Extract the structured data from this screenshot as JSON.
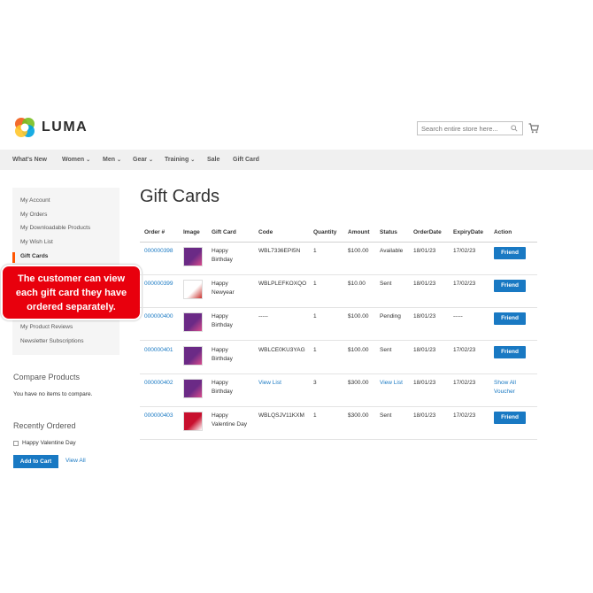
{
  "brand": {
    "name": "LUMA"
  },
  "header": {
    "search_placeholder": "Search entire store here...",
    "cart_icon": "cart-icon"
  },
  "nav": {
    "items": [
      {
        "label": "What's New",
        "dropdown": false
      },
      {
        "label": "Women",
        "dropdown": true
      },
      {
        "label": "Men",
        "dropdown": true
      },
      {
        "label": "Gear",
        "dropdown": true
      },
      {
        "label": "Training",
        "dropdown": true
      },
      {
        "label": "Sale",
        "dropdown": false
      },
      {
        "label": "Gift Card",
        "dropdown": false
      }
    ]
  },
  "sidebar": {
    "items": [
      {
        "label": "My Account",
        "active": false
      },
      {
        "label": "My Orders",
        "active": false
      },
      {
        "label": "My Downloadable Products",
        "active": false
      },
      {
        "label": "My Wish List",
        "active": false
      },
      {
        "label": "Gift Cards",
        "active": true
      },
      {
        "label": "My Product Reviews",
        "active": false
      },
      {
        "label": "Newsletter Subscriptions",
        "active": false
      }
    ],
    "active_color": "#ff5501"
  },
  "callout": {
    "lines": [
      "The customer can view",
      "each gift card they have",
      "ordered separately."
    ],
    "color": "#e8000d"
  },
  "compare": {
    "title": "Compare Products",
    "empty_text": "You have no items to compare."
  },
  "recent": {
    "title": "Recently Ordered",
    "item": "Happy Valentine Day",
    "add_to_cart": "Add to Cart",
    "view_all": "View All"
  },
  "main": {
    "title": "Gift Cards",
    "columns": [
      "Order #",
      "Image",
      "Gift Card",
      "Code",
      "Quantity",
      "Amount",
      "Status",
      "OrderDate",
      "ExpiryDate",
      "Action"
    ],
    "rows": [
      {
        "order": "000000398",
        "gift_card": [
          "Happy",
          "Birthday"
        ],
        "code": "WBL7336EPI5N",
        "code_link": false,
        "quantity": "1",
        "amount": "$100.00",
        "status": "Available",
        "status_link": false,
        "order_date": "18/01/23",
        "expiry_date": "17/02/23",
        "action": [
          "Friend"
        ],
        "action_type": "button",
        "image": "birthday"
      },
      {
        "order": "000000399",
        "gift_card": [
          "Happy",
          "Newyear"
        ],
        "code": "WBLPLEFKOXQO",
        "code_link": false,
        "quantity": "1",
        "amount": "$10.00",
        "status": "Sent",
        "status_link": false,
        "order_date": "18/01/23",
        "expiry_date": "17/02/23",
        "action": [
          "Friend"
        ],
        "action_type": "button",
        "image": "newyear"
      },
      {
        "order": "000000400",
        "gift_card": [
          "Happy",
          "Birthday"
        ],
        "code": "-----",
        "code_link": false,
        "quantity": "1",
        "amount": "$100.00",
        "status": "Pending",
        "status_link": false,
        "order_date": "18/01/23",
        "expiry_date": "-----",
        "action": [
          "Friend"
        ],
        "action_type": "button",
        "image": "birthday"
      },
      {
        "order": "000000401",
        "gift_card": [
          "Happy",
          "Birthday"
        ],
        "code": "WBLCE0KU3YAG",
        "code_link": false,
        "quantity": "1",
        "amount": "$100.00",
        "status": "Sent",
        "status_link": false,
        "order_date": "18/01/23",
        "expiry_date": "17/02/23",
        "action": [
          "Friend"
        ],
        "action_type": "button",
        "image": "birthday"
      },
      {
        "order": "000000402",
        "gift_card": [
          "Happy",
          "Birthday"
        ],
        "code": "View List",
        "code_link": true,
        "quantity": "3",
        "amount": "$300.00",
        "status": "View List",
        "status_link": true,
        "order_date": "18/01/23",
        "expiry_date": "17/02/23",
        "action": [
          "Show All",
          "Voucher"
        ],
        "action_type": "link",
        "image": "birthday"
      },
      {
        "order": "000000403",
        "gift_card": [
          "Happy",
          "Valentine Day"
        ],
        "code": "WBLQSJV11KXM",
        "code_link": false,
        "quantity": "1",
        "amount": "$300.00",
        "status": "Sent",
        "status_link": false,
        "order_date": "18/01/23",
        "expiry_date": "17/02/23",
        "action": [
          "Friend"
        ],
        "action_type": "button",
        "image": "valentine"
      }
    ]
  },
  "colors": {
    "link": "#1979c3",
    "button": "#1979c3",
    "nav_bg": "#f0f0f0",
    "sidebar_bg": "#f5f5f5"
  }
}
